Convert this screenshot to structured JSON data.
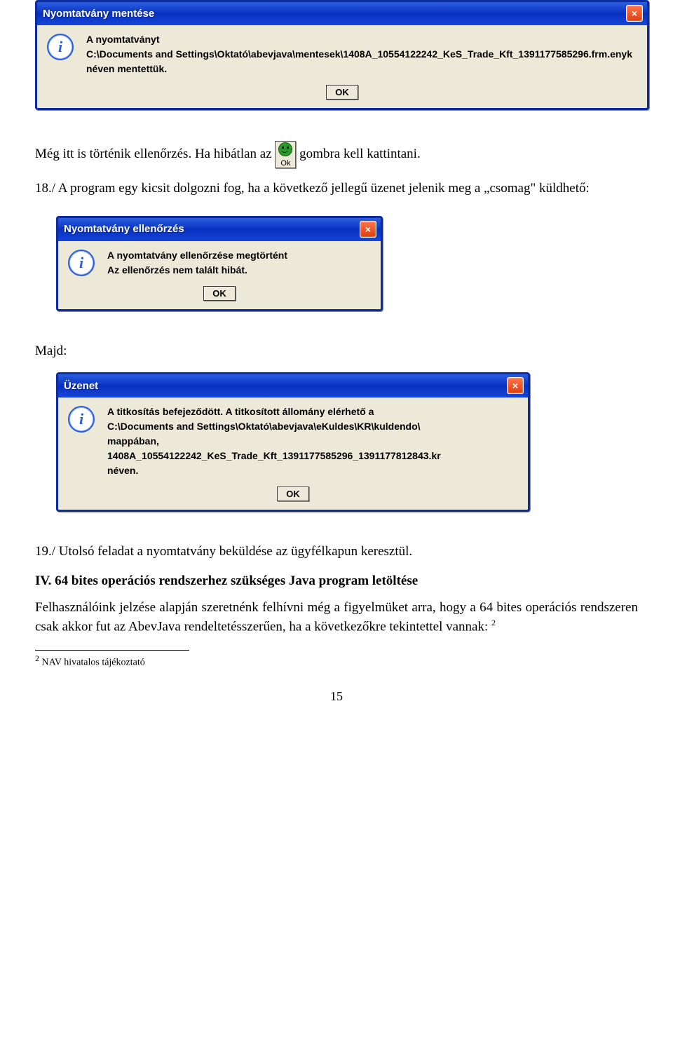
{
  "dialog1": {
    "title": "Nyomtatvány mentése",
    "line1": "A nyomtatványt",
    "line2": "C:\\Documents and Settings\\Oktató\\abevjava\\mentesek\\1408A_10554122242_KeS_Trade_Kft_1391177585296.frm.enyk",
    "line3": "néven mentettük.",
    "ok": "OK"
  },
  "para1_a": "Még itt is történik ellenőrzés. Ha hibátlan az ",
  "para1_b": " gombra kell kattintani.",
  "ok_icon_label": "Ok",
  "para2": "18./ A program egy kicsit dolgozni fog, ha a következő jellegű üzenet jelenik meg a „csomag\" küldhető:",
  "dialog2": {
    "title": "Nyomtatvány ellenőrzés",
    "line1": "A nyomtatvány ellenőrzése megtörtént",
    "line2": "Az ellenőrzés nem talált hibát.",
    "ok": "OK"
  },
  "majd": "Majd:",
  "dialog3": {
    "title": "Üzenet",
    "line1": "A titkosítás befejeződött. A titkosított állomány elérhető a",
    "line2": "C:\\Documents and Settings\\Oktató\\abevjava\\eKuldes\\KR\\kuldendo\\",
    "line3": "mappában,",
    "line4": "1408A_10554122242_KeS_Trade_Kft_1391177585296_1391177812843.kr",
    "line5": "néven.",
    "ok": "OK"
  },
  "para3": "19./ Utolsó feladat a nyomtatvány beküldése az ügyfélkapun keresztül.",
  "heading": "IV. 64 bites operációs rendszerhez szükséges Java program letöltése",
  "para4": "Felhasználóink jelzése alapján szeretnénk felhívni még a figyelmüket arra, hogy a 64 bites operációs rendszeren csak akkor fut az AbevJava rendeltetésszerűen, ha a következőkre tekintettel vannak: ",
  "fn_mark": "2",
  "footnote": " NAV hivatalos tájékoztató",
  "pagenum": "15"
}
